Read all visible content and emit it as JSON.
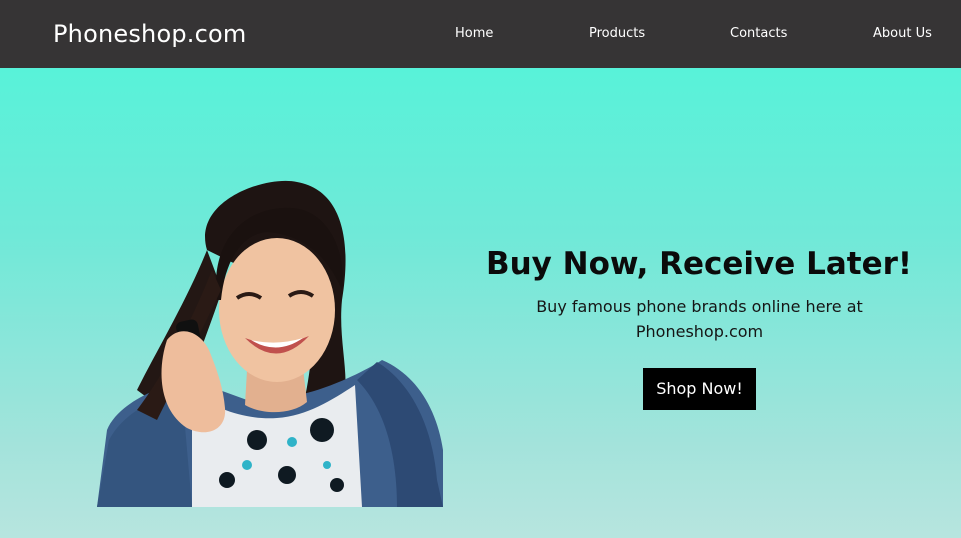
{
  "header": {
    "brand": "Phoneshop.com",
    "nav": [
      {
        "label": "Home"
      },
      {
        "label": "Products"
      },
      {
        "label": "Contacts"
      },
      {
        "label": "About Us"
      }
    ]
  },
  "hero": {
    "headline": "Buy Now, Receive Later!",
    "subtext": "Buy famous phone brands online here at Phoneshop.com",
    "cta_label": "Shop Now!",
    "image_icon": "woman-on-phone-photo"
  },
  "colors": {
    "header_bg": "#363435",
    "hero_top": "#58f2d9",
    "hero_bottom": "#b7e5df",
    "cta_bg": "#000000",
    "text": "#0b0b0b"
  }
}
